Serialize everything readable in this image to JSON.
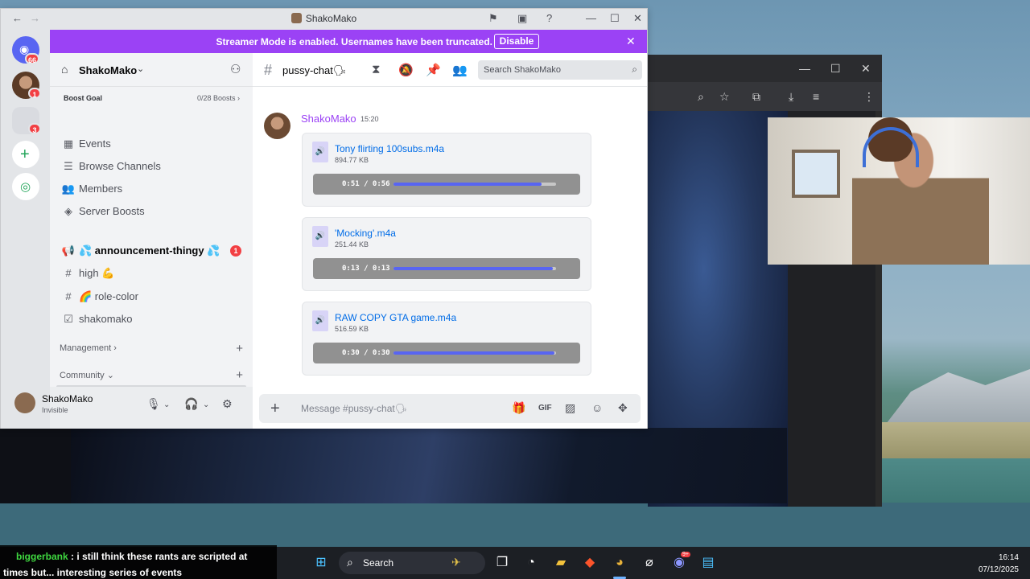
{
  "discord": {
    "window_title": "ShakoMako",
    "rail_badges": [
      "66",
      "1",
      "3"
    ],
    "banner": {
      "text": "Streamer Mode is enabled. Usernames have been truncated.",
      "button": "Disable"
    },
    "server": {
      "name": "ShakoMako",
      "boost_label": "Boost Goal",
      "boost_value": "0/28 Boosts"
    },
    "menu": [
      {
        "label": "Events",
        "icon": "calendar-icon"
      },
      {
        "label": "Browse Channels",
        "icon": "list-icon"
      },
      {
        "label": "Members",
        "icon": "members-icon"
      },
      {
        "label": "Server Boosts",
        "icon": "boost-icon"
      }
    ],
    "channels": [
      {
        "label": "💦 announcement-thingy 💦",
        "icon": "megaphone-icon",
        "badge": "1"
      },
      {
        "label": "high 💪",
        "icon": "hash-icon"
      },
      {
        "label": "🌈 role-color",
        "icon": "hash-icon"
      },
      {
        "label": "shakomako",
        "icon": "checkbox-icon"
      }
    ],
    "categories": [
      "Management",
      "Community"
    ],
    "user": {
      "name": "ShakoMako",
      "status": "Invisible"
    },
    "chat": {
      "channel_name": "pussy-chat🗣",
      "search_placeholder": "Search ShakoMako",
      "message": {
        "author": "ShakoMako",
        "time": "15:20"
      },
      "attachments": [
        {
          "name": "Tony flirting 100subs.m4a",
          "size": "894.77 KB",
          "time": "0:51 / 0:56",
          "progress": 0.91
        },
        {
          "name": "'Mocking'.m4a",
          "size": "251.44 KB",
          "time": "0:13 / 0:13",
          "progress": 0.98
        },
        {
          "name": "RAW COPY GTA game.m4a",
          "size": "516.59 KB",
          "time": "0:30 / 0:30",
          "progress": 0.99
        }
      ],
      "composer_placeholder": "Message #pussy-chat🗣"
    }
  },
  "taskbar": {
    "search": "Search",
    "time": "16:14",
    "date": "07/12/2025",
    "discord_badge": "9+"
  },
  "overlay": {
    "username": "biggerbank",
    "message": ": i still think these rants are scripted at times but... interesting series of events"
  },
  "colors": {
    "banner": "#9b42f5",
    "accent": "#5865f2",
    "link": "#006ce7"
  }
}
